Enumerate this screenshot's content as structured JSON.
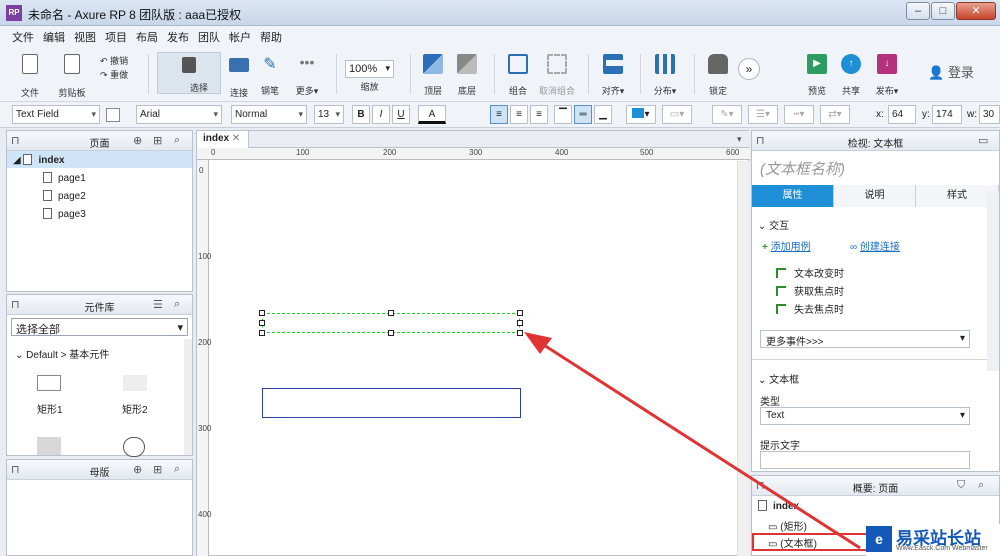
{
  "window": {
    "title": "未命名 - Axure RP 8 团队版 : aaa已授权",
    "app_icon": "RP"
  },
  "menu": [
    "文件",
    "编辑",
    "视图",
    "项目",
    "布局",
    "发布",
    "团队",
    "帐户",
    "帮助"
  ],
  "toolbar": {
    "file": "文件",
    "clipboard": "剪贴板",
    "undo": "撤销",
    "redo": "重做",
    "select": "选择",
    "connect": "连接",
    "pen": "钢笔",
    "more": "更多",
    "zoom_value": "100%",
    "zoom_label": "缩放",
    "front": "顶层",
    "back": "底层",
    "group": "组合",
    "ungroup": "取消组合",
    "align": "对齐",
    "distribute": "分布",
    "lock": "锁定",
    "preview": "预览",
    "share": "共享",
    "publish": "发布",
    "login": "登录"
  },
  "formatbar": {
    "widget_type": "Text Field",
    "font": "Arial",
    "weight": "Normal",
    "size": "13",
    "bold": "B",
    "italic": "I",
    "underline": "U",
    "font_color": "A",
    "x_label": "x:",
    "x_value": "64",
    "y_label": "y:",
    "y_value": "174",
    "w_label": "w:",
    "w_value": "30"
  },
  "pages_panel": {
    "title": "页面",
    "root": "index",
    "children": [
      "page1",
      "page2",
      "page3"
    ]
  },
  "library_panel": {
    "title": "元件库",
    "select_value": "选择全部",
    "group": "Default > 基本元件",
    "items": [
      "矩形1",
      "矩形2"
    ]
  },
  "masters_panel": {
    "title": "母版"
  },
  "canvas": {
    "tab": "index",
    "ruler_h": [
      "0",
      "100",
      "200",
      "300",
      "400",
      "500",
      "600"
    ],
    "ruler_v": [
      "0",
      "100",
      "200",
      "300",
      "400"
    ]
  },
  "inspector": {
    "title": "检视: 文本框",
    "name_placeholder": "(文本框名称)",
    "tabs": [
      "属性",
      "说明",
      "样式"
    ],
    "interaction_header": "交互",
    "add_case": "添加用例",
    "create_link": "创建连接",
    "events": [
      "文本改变时",
      "获取焦点时",
      "失去焦点时"
    ],
    "more_events": "更多事件>>>",
    "textbox_header": "文本框",
    "type_label": "类型",
    "type_value": "Text",
    "hint_label": "提示文字"
  },
  "outline_panel": {
    "title": "概要: 页面",
    "root": "index",
    "items": [
      "(矩形)",
      "(文本框)"
    ]
  },
  "watermark": {
    "brand": "易采站长站",
    "url": "Www.Easck.Com Webmaster"
  },
  "colors": {
    "accent": "#1e8fd6",
    "selection": "#22cc22",
    "arrow": "#e03434",
    "rect_border": "#2b3ea8"
  }
}
